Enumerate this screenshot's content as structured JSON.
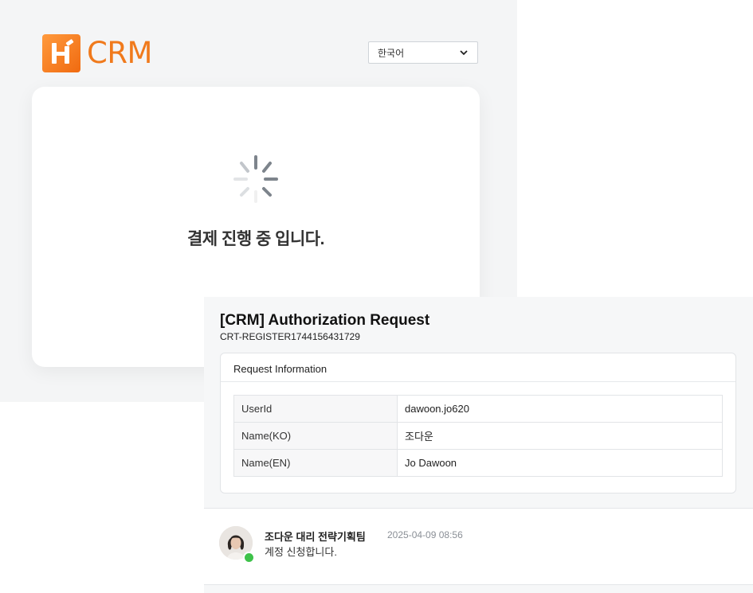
{
  "background_page": {
    "logo": {
      "mark_letter": "H",
      "text": "CRM",
      "color": "#f07a1c"
    },
    "language_select": {
      "selected": "한국어",
      "icon": "chevron-down-icon"
    },
    "loading": {
      "icon": "spinner-icon",
      "message": "결제 진행 중 입니다."
    }
  },
  "request": {
    "title": "[CRM] Authorization Request",
    "code": "CRT-REGISTER1744156431729",
    "info_heading": "Request Information",
    "rows": [
      {
        "label": "UserId",
        "value": "dawoon.jo620"
      },
      {
        "label": "Name(KO)",
        "value": "조다운"
      },
      {
        "label": "Name(EN)",
        "value": "Jo Dawoon"
      }
    ]
  },
  "comment": {
    "author": "조다운 대리 전략기획팀",
    "time": "2025-04-09 08:56",
    "body": "계정 신청합니다.",
    "status_color": "#3ec24a"
  }
}
